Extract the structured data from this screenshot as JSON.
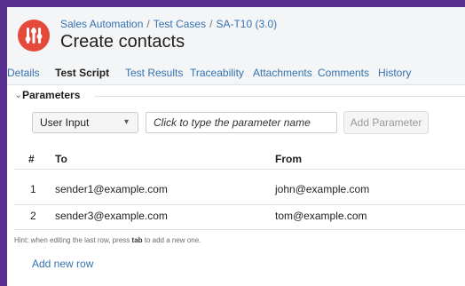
{
  "colors": {
    "frame": "#5a2d91",
    "link": "#3572b0",
    "logo": "#e5493a"
  },
  "header": {
    "logo_icon": "sliders-icon",
    "breadcrumb": [
      "Sales Automation",
      "Test Cases",
      "SA-T10 (3.0)"
    ],
    "separator": "/",
    "title": "Create contacts"
  },
  "tabs": [
    {
      "label": "Details",
      "active": false
    },
    {
      "label": "Test Script",
      "active": true
    },
    {
      "label": "Test Results",
      "active": false
    },
    {
      "label": "Traceability",
      "active": false
    },
    {
      "label": "Attachments",
      "active": false
    },
    {
      "label": "Comments",
      "active": false
    },
    {
      "label": "History",
      "active": false
    }
  ],
  "parameters": {
    "section_label": "Parameters",
    "chevron_icon": "chevron-down-icon",
    "type_select": "User Input",
    "name_placeholder": "Click to type the parameter name",
    "add_button": "Add Parameter",
    "columns": [
      "#",
      "To",
      "From"
    ],
    "rows": [
      {
        "num": "1",
        "to": "sender1@example.com",
        "from": "john@example.com"
      },
      {
        "num": "2",
        "to": "sender3@example.com",
        "from": "tom@example.com"
      }
    ],
    "hint_prefix": "Hint: when editing the last row, press",
    "hint_key": "tab",
    "hint_suffix": "to add a new one.",
    "add_row_label": "Add new row"
  }
}
